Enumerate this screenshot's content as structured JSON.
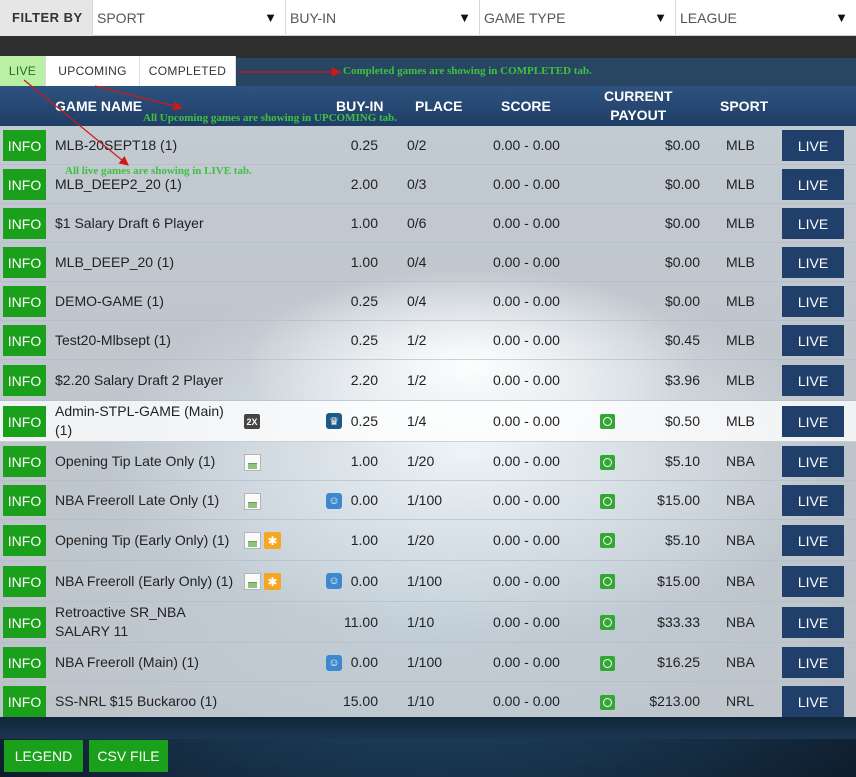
{
  "filter": {
    "label": "FILTER BY",
    "sport": "SPORT",
    "buyin": "BUY-IN",
    "game_type": "GAME TYPE",
    "league": "LEAGUE"
  },
  "tabs": [
    "LIVE",
    "UPCOMING",
    "COMPLETED"
  ],
  "annotations": {
    "completed": "Completed games are showing in COMPLETED tab.",
    "upcoming": "All Upcoming games are showing in UPCOMING tab.",
    "live": "All live games are showing in LIVE tab."
  },
  "columns": {
    "game_name": "GAME NAME",
    "buyin": "BUY-IN",
    "place": "PLACE",
    "score": "SCORE",
    "current": "CURRENT",
    "payout": "PAYOUT",
    "sport": "SPORT"
  },
  "info_label": "INFO",
  "live_label": "LIVE",
  "badge_2x": "2X",
  "rows": [
    {
      "name": "MLB-20SEPT18 (1)",
      "buyin": "0.25",
      "place": "0/2",
      "score": "0.00 - 0.00",
      "payout": "$0.00",
      "sport": "MLB"
    },
    {
      "name": "MLB_DEEP2_20 (1)",
      "buyin": "2.00",
      "place": "0/3",
      "score": "0.00 - 0.00",
      "payout": "$0.00",
      "sport": "MLB"
    },
    {
      "name": "$1 Salary Draft 6 Player",
      "buyin": "1.00",
      "place": "0/6",
      "score": "0.00 - 0.00",
      "payout": "$0.00",
      "sport": "MLB"
    },
    {
      "name": "MLB_DEEP_20 (1)",
      "buyin": "1.00",
      "place": "0/4",
      "score": "0.00 - 0.00",
      "payout": "$0.00",
      "sport": "MLB"
    },
    {
      "name": "DEMO-GAME (1)",
      "buyin": "0.25",
      "place": "0/4",
      "score": "0.00 - 0.00",
      "payout": "$0.00",
      "sport": "MLB"
    },
    {
      "name": "Test20-Mlbsept (1)",
      "buyin": "0.25",
      "place": "1/2",
      "score": "0.00 - 0.00",
      "payout": "$0.45",
      "sport": "MLB"
    },
    {
      "name": "$2.20 Salary Draft 2 Player",
      "buyin": "2.20",
      "place": "1/2",
      "score": "0.00 - 0.00",
      "payout": "$3.96",
      "sport": "MLB"
    },
    {
      "name": "Admin-STPL-GAME (Main) (1)",
      "buyin": "0.25",
      "place": "1/4",
      "score": "0.00 - 0.00",
      "payout": "$0.50",
      "sport": "MLB"
    },
    {
      "name": "Opening Tip Late Only (1)",
      "buyin": "1.00",
      "place": "1/20",
      "score": "0.00 - 0.00",
      "payout": "$5.10",
      "sport": "NBA"
    },
    {
      "name": "NBA Freeroll Late Only (1)",
      "buyin": "0.00",
      "place": "1/100",
      "score": "0.00 - 0.00",
      "payout": "$15.00",
      "sport": "NBA"
    },
    {
      "name": "Opening Tip (Early Only) (1)",
      "buyin": "1.00",
      "place": "1/20",
      "score": "0.00 - 0.00",
      "payout": "$5.10",
      "sport": "NBA"
    },
    {
      "name": "NBA Freeroll (Early Only) (1)",
      "buyin": "0.00",
      "place": "1/100",
      "score": "0.00 - 0.00",
      "payout": "$15.00",
      "sport": "NBA"
    },
    {
      "name": "Retroactive SR_NBA SALARY 11",
      "buyin": "11.00",
      "place": "1/10",
      "score": "0.00 - 0.00",
      "payout": "$33.33",
      "sport": "NBA"
    },
    {
      "name": "NBA Freeroll (Main) (1)",
      "buyin": "0.00",
      "place": "1/100",
      "score": "0.00 - 0.00",
      "payout": "$16.25",
      "sport": "NBA"
    },
    {
      "name": "SS-NRL $15 Buckaroo (1)",
      "buyin": "15.00",
      "place": "1/10",
      "score": "0.00 - 0.00",
      "payout": "$213.00",
      "sport": "NRL"
    }
  ],
  "buttons": {
    "legend": "LEGEND",
    "csv": "CSV FILE"
  },
  "colors": {
    "info_green": "#1aa01a",
    "live_navy": "#213f6b",
    "header_blue": "#2e527f",
    "annotation_green": "#3ec23e",
    "arrow_red": "#d01818"
  }
}
